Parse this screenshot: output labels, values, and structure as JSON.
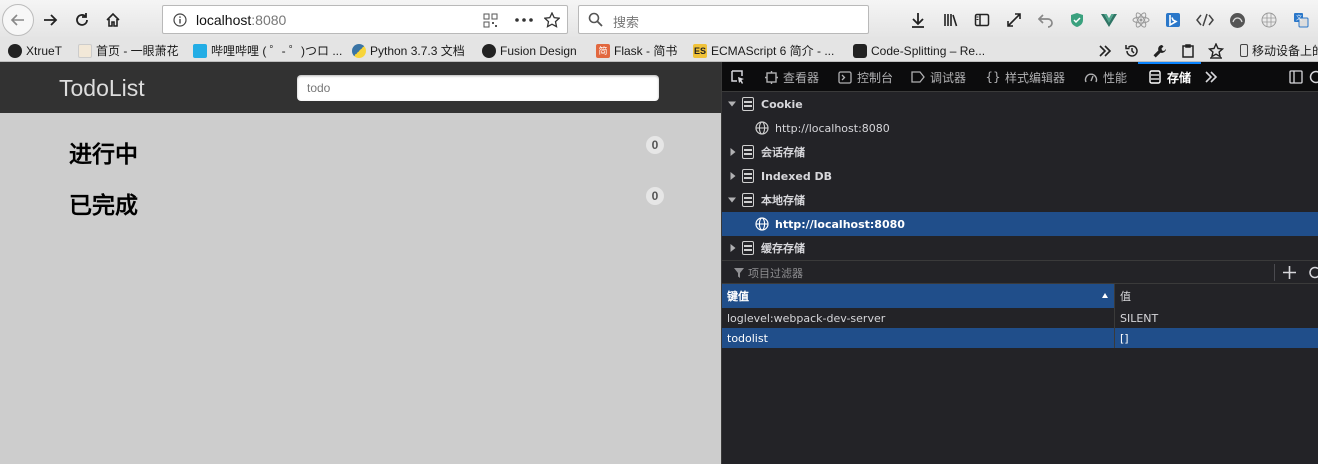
{
  "browser": {
    "url_host": "localhost",
    "url_port": ":8080",
    "search_placeholder": "搜索"
  },
  "bookmarks": [
    {
      "label": "XtrueT",
      "icon": "github-icon"
    },
    {
      "label": "首页 - 一眼萧花",
      "icon": "page-icon"
    },
    {
      "label": "哔哩哔哩 ( ゜- ゜)つロ ...",
      "icon": "bilibili-icon"
    },
    {
      "label": "Python 3.7.3 文档",
      "icon": "python-icon"
    },
    {
      "label": "Fusion Design",
      "icon": "fusion-icon"
    },
    {
      "label": "Flask - 简书",
      "icon": "jianshu-icon"
    },
    {
      "label": "ECMAScript 6 简介 - ...",
      "icon": "es-icon"
    },
    {
      "label": "Code-Splitting – Re...",
      "icon": "react-icon"
    },
    {
      "label": "移动设备上的",
      "icon": "mobile-icon"
    }
  ],
  "app": {
    "title": "TodoList",
    "input_placeholder": "todo",
    "sections": [
      {
        "title": "进行中",
        "count": "0"
      },
      {
        "title": "已完成",
        "count": "0"
      }
    ]
  },
  "devtools": {
    "tabs": [
      "查看器",
      "控制台",
      "调试器",
      "样式编辑器",
      "性能",
      "存储"
    ],
    "active_tab": "存储",
    "tree": [
      {
        "label": "Cookie",
        "expanded": true
      },
      {
        "label": "http://localhost:8080",
        "child": true
      },
      {
        "label": "会话存储",
        "expanded": false
      },
      {
        "label": "Indexed DB",
        "expanded": false
      },
      {
        "label": "本地存储",
        "expanded": true
      },
      {
        "label": "http://localhost:8080",
        "child": true,
        "selected": true
      },
      {
        "label": "缓存存储",
        "expanded": false
      }
    ],
    "filter_placeholder": "项目过滤器",
    "columns": {
      "key": "键值",
      "value": "值"
    },
    "rows": [
      {
        "key": "loglevel:webpack-dev-server",
        "value": "SILENT"
      },
      {
        "key": "todolist",
        "value": "[]"
      }
    ],
    "colors": {
      "accent": "#0a84ff",
      "selection": "#204e8a"
    }
  }
}
